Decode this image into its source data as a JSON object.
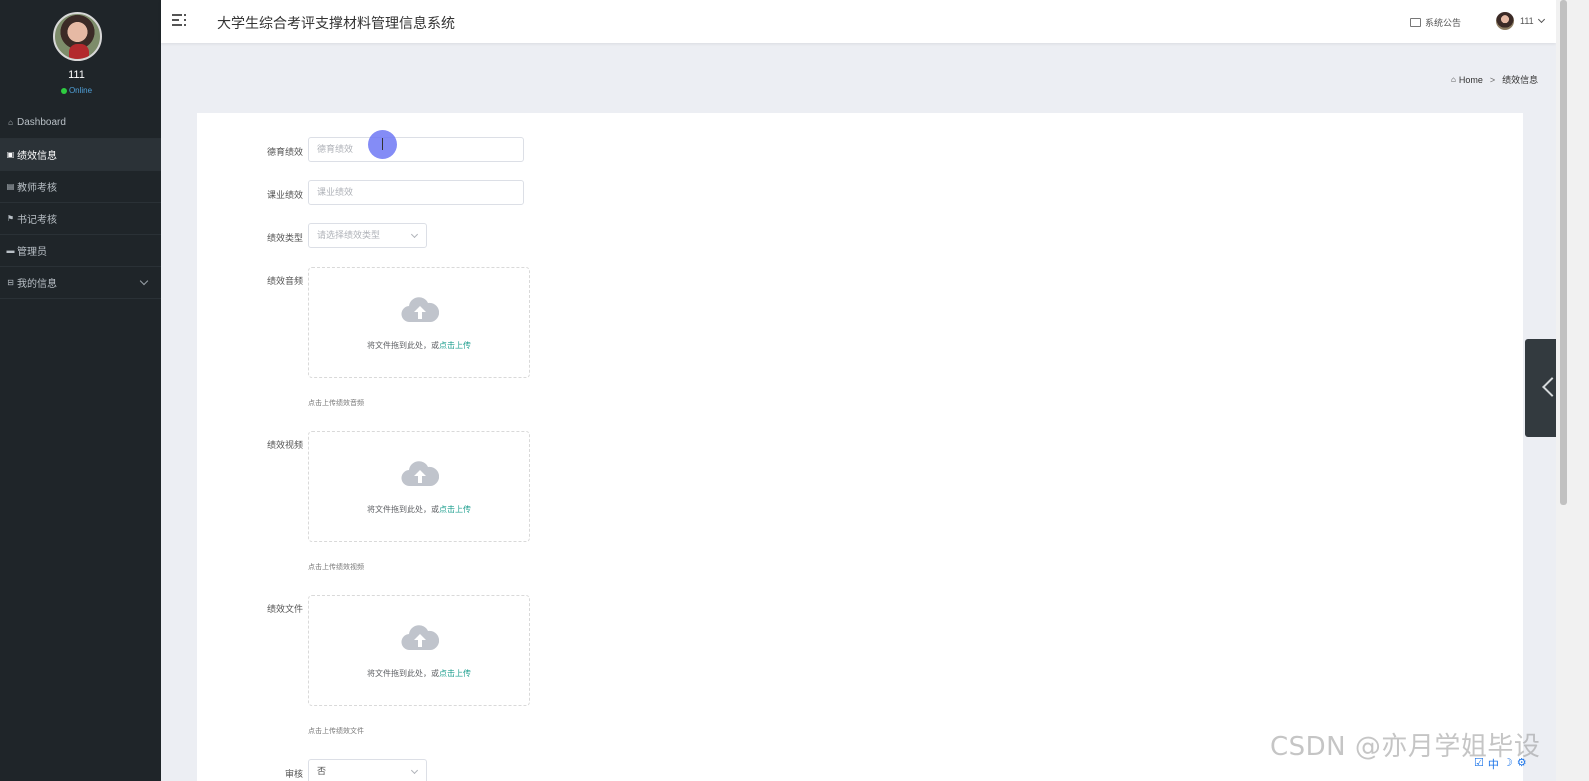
{
  "user": {
    "name": "111",
    "status": "Online"
  },
  "sidebar": {
    "items": [
      {
        "label": "Dashboard",
        "icon": "home-icon"
      },
      {
        "label": "绩效信息",
        "icon": "doc-icon"
      },
      {
        "label": "教师考核",
        "icon": "doc-icon"
      },
      {
        "label": "书记考核",
        "icon": "flag-icon"
      },
      {
        "label": "管理员",
        "icon": "card-icon"
      },
      {
        "label": "我的信息",
        "icon": "card-icon"
      }
    ]
  },
  "header": {
    "title": "大学生综合考评支撑材料管理信息系统",
    "notice_label": "系统公告",
    "user_label": "111"
  },
  "breadcrumb": {
    "home": "Home",
    "current": "绩效信息"
  },
  "form": {
    "moral_label": "德育绩效",
    "moral_placeholder": "德育绩效",
    "study_label": "课业绩效",
    "study_placeholder": "课业绩效",
    "type_label": "绩效类型",
    "type_placeholder": "请选择绩效类型",
    "audio_label": "绩效音频",
    "audio_tip": "点击上传绩效音频",
    "video_label": "绩效视频",
    "video_tip": "点击上传绩效视频",
    "file_label": "绩效文件",
    "file_tip": "点击上传绩效文件",
    "upload_text": "将文件拖到此处，或",
    "upload_link": "点击上传",
    "review_label": "审核",
    "review_value": "否"
  },
  "watermark": "CSDN @亦月学姐毕设",
  "colors": {
    "sidebar_bg": "#1f2529",
    "accent": "#20a090",
    "online": "#2ecc40"
  }
}
